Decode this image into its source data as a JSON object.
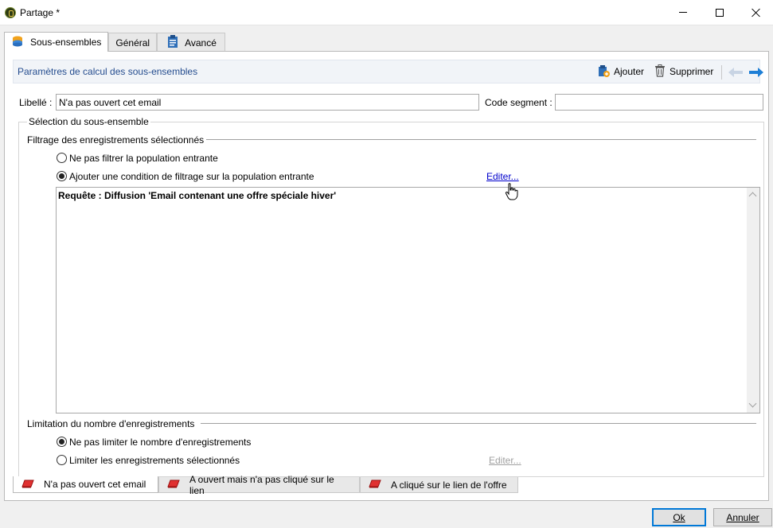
{
  "window": {
    "title": "Partage *"
  },
  "tabs": [
    {
      "label": "Sous-ensembles",
      "icon": "database-icon",
      "active": true
    },
    {
      "label": "Général",
      "active": false
    },
    {
      "label": "Avancé",
      "icon": "clipboard-icon",
      "active": false
    }
  ],
  "toolbar": {
    "title": "Paramètres de calcul des sous-ensembles",
    "add_label": "Ajouter",
    "delete_label": "Supprimer"
  },
  "form": {
    "label_caption": "Libellé :",
    "label_value": "N'a pas ouvert cet email",
    "segment_caption": "Code segment :",
    "segment_value": ""
  },
  "selection": {
    "group_title": "Sélection du sous-ensemble",
    "filter_title": "Filtrage des enregistrements sélectionnés",
    "option_no_filter": "Ne pas filtrer la population entrante",
    "option_add_condition": "Ajouter une condition de filtrage sur la population entrante",
    "selected": "add_condition",
    "edit_link": "Editer...",
    "query_text": "Requête : Diffusion 'Email contenant une offre spéciale hiver'"
  },
  "limitation": {
    "title": "Limitation du nombre d'enregistrements",
    "option_no_limit": "Ne pas limiter le nombre d'enregistrements",
    "option_limit": "Limiter les enregistrements sélectionnés",
    "selected": "no_limit",
    "edit_link": "Editer..."
  },
  "subset_tabs": [
    {
      "label": "N'a pas ouvert cet email",
      "active": true
    },
    {
      "label": "A ouvert mais n'a pas cliqué sur le lien",
      "active": false
    },
    {
      "label": "A cliqué sur le lien de l'offre",
      "active": false
    }
  ],
  "buttons": {
    "ok": "Ok",
    "cancel": "Annuler"
  },
  "colors": {
    "accent": "#0078d7",
    "link": "#0000cc",
    "toolbar_title": "#254d8f",
    "segment_icon": "#e03030"
  }
}
